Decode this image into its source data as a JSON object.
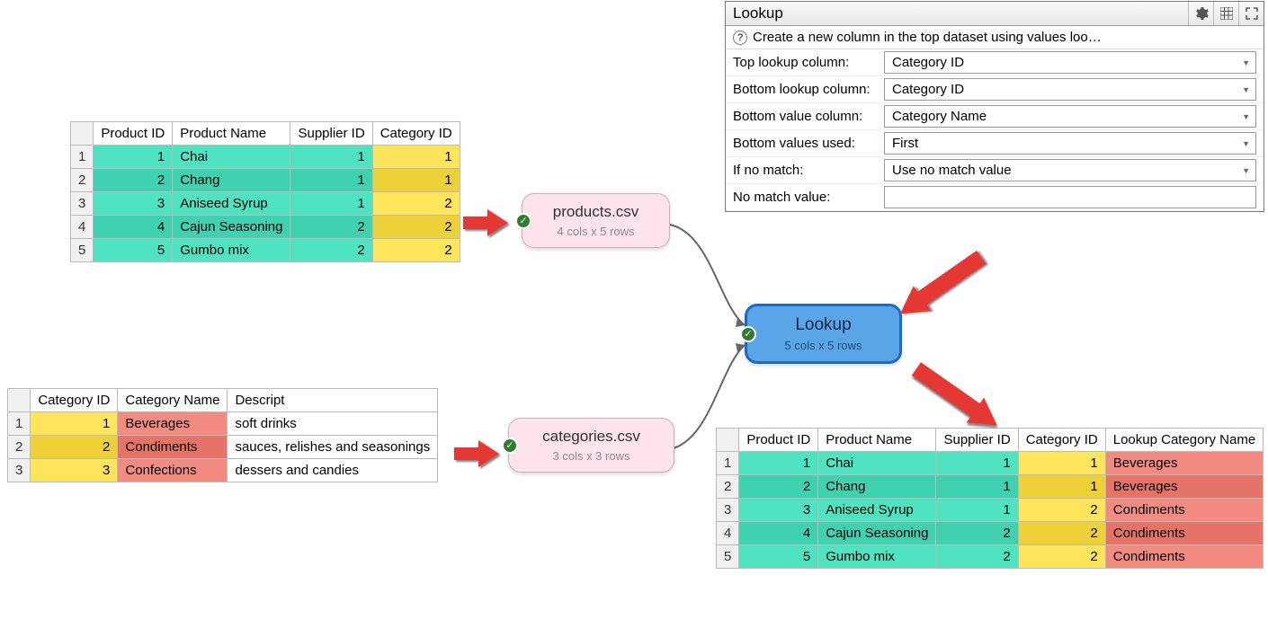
{
  "tables": {
    "products": {
      "headers": [
        "Product ID",
        "Product Name",
        "Supplier ID",
        "Category ID"
      ],
      "rows": [
        [
          "1",
          "Chai",
          "1",
          "1"
        ],
        [
          "2",
          "Chang",
          "1",
          "1"
        ],
        [
          "3",
          "Aniseed Syrup",
          "1",
          "2"
        ],
        [
          "4",
          "Cajun Seasoning",
          "2",
          "2"
        ],
        [
          "5",
          "Gumbo mix",
          "2",
          "2"
        ]
      ]
    },
    "categories": {
      "headers": [
        "Category ID",
        "Category Name",
        "Descript"
      ],
      "rows": [
        [
          "1",
          "Beverages",
          "soft drinks"
        ],
        [
          "2",
          "Condiments",
          "sauces, relishes and seasonings"
        ],
        [
          "3",
          "Confections",
          "dessers and candies"
        ]
      ]
    },
    "result": {
      "headers": [
        "Product ID",
        "Product Name",
        "Supplier ID",
        "Category ID",
        "Lookup Category Name"
      ],
      "rows": [
        [
          "1",
          "Chai",
          "1",
          "1",
          "Beverages"
        ],
        [
          "2",
          "Chang",
          "1",
          "1",
          "Beverages"
        ],
        [
          "3",
          "Aniseed Syrup",
          "1",
          "2",
          "Condiments"
        ],
        [
          "4",
          "Cajun Seasoning",
          "2",
          "2",
          "Condiments"
        ],
        [
          "5",
          "Gumbo mix",
          "2",
          "2",
          "Condiments"
        ]
      ]
    }
  },
  "nodes": {
    "products": {
      "title": "products.csv",
      "subtitle": "4 cols x 5 rows"
    },
    "categories": {
      "title": "categories.csv",
      "subtitle": "3 cols x 3 rows"
    },
    "lookup": {
      "title": "Lookup",
      "subtitle": "5 cols x 5 rows"
    }
  },
  "panel": {
    "title": "Lookup",
    "help": "Create a new column in the top dataset using values loo…",
    "fields": {
      "top_col_label": "Top lookup column:",
      "top_col_value": "Category ID",
      "bottom_col_label": "Bottom lookup column:",
      "bottom_col_value": "Category ID",
      "bottom_val_label": "Bottom value column:",
      "bottom_val_value": "Category Name",
      "bottom_used_label": "Bottom values used:",
      "bottom_used_value": "First",
      "if_no_match_label": "If no match:",
      "if_no_match_value": "Use no match value",
      "no_match_label": "No match value:",
      "no_match_value": ""
    }
  }
}
